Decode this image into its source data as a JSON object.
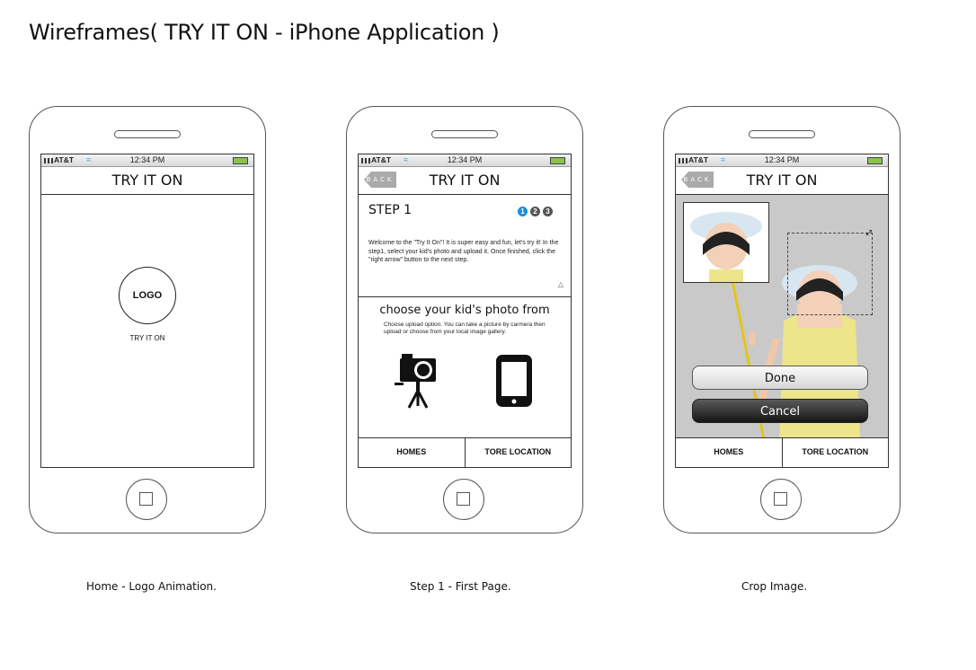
{
  "title": "Wireframes(  TRY IT ON - iPhone Application  )",
  "status_bar": {
    "carrier": "AT&T",
    "time": "12:34 PM"
  },
  "phones": [
    {
      "caption": "Home - Logo Animation.",
      "nav_title": "TRY IT ON",
      "logo_text": "LOGO",
      "logo_caption": "TRY IT ON"
    },
    {
      "caption": "Step 1 -  First Page.",
      "nav_title": "TRY IT ON",
      "back_label": "BACK",
      "step_title": "STEP 1",
      "step_dots": [
        "1",
        "2",
        "3"
      ],
      "description": "Welcome to the \"Try It On\"!  It is super easy and fun, let's try it! In the step1, select your kid's photo and upload it. Once finished, click the \"right arrow\" button to the next step.",
      "choose_title": "choose your kid's photo from",
      "choose_desc": "Choose upload option. You can take a picture by carmera then upload or choose from your local image gallery.",
      "tabs": [
        "HOMES",
        "TORE LOCATION"
      ]
    },
    {
      "caption": "Crop Image.",
      "nav_title": "TRY IT ON",
      "back_label": "BACK",
      "done_label": "Done",
      "cancel_label": "Cancel",
      "tabs": [
        "HOMES",
        "TORE LOCATION"
      ]
    }
  ],
  "colors": {
    "accent": "#1a8fd6",
    "battery": "#8bc34a",
    "wifi": "#4aa3d8"
  },
  "icons": [
    "wifi-icon",
    "battery-icon",
    "camera-tripod-icon",
    "smartphone-icon",
    "resize-arrow-icon",
    "up-triangle-icon"
  ]
}
